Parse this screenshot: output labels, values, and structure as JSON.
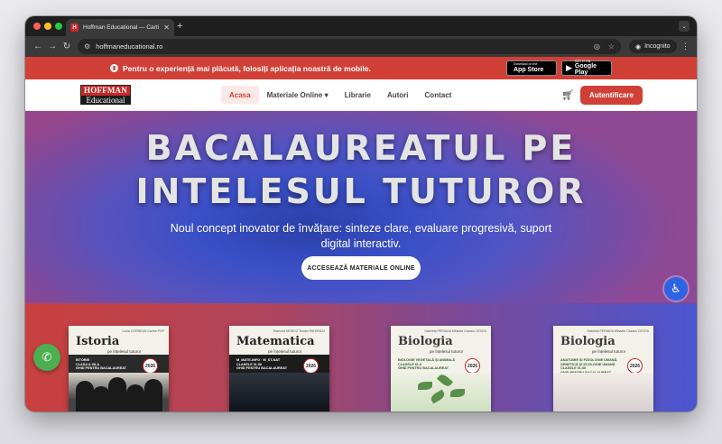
{
  "browser": {
    "tab_title": "Hoffman Educational — Carti",
    "tab_favicon_letter": "H",
    "url": "hoffmaneducational.ro",
    "incognito_label": "Incognito",
    "new_tab_glyph": "+",
    "close_tab_glyph": "✕"
  },
  "promo": {
    "text": "Pentru o experiență mai plăcută, folosiți aplicația noastră de mobile.",
    "apple_small": "Download on the",
    "apple_big": "App Store",
    "google_small": "GET IT ON",
    "google_big": "Google Play",
    "background": "#d14036"
  },
  "nav": {
    "logo_top": "HOFFMAN",
    "logo_bottom": "Educational",
    "items": [
      {
        "label": "Acasa",
        "active": true
      },
      {
        "label": "Materiale Online ▾",
        "active": false
      },
      {
        "label": "Librarie",
        "active": false
      },
      {
        "label": "Autori",
        "active": false
      },
      {
        "label": "Contact",
        "active": false
      }
    ],
    "login_label": "Autentificare",
    "accent": "#d14036"
  },
  "hero": {
    "title_line1": "BACALAUREATUL PE",
    "title_line2": "INTELESUL TUTUROR",
    "subtitle": "Noul concept inovator de învățare: sinteze clare, evaluare progresivă, suport digital interactiv.",
    "cta_label": "ACCESEAZĂ MATERIALE ONLINE"
  },
  "books": [
    {
      "title": "Istoria",
      "subtitle": "pe înțelesul tuturor",
      "authors": "Lucia CORNEAN\nCarina POP",
      "band": "ISTORIE\nCLASA A XII-A\nGHID PENTRU BACALAUREAT",
      "year": "2026"
    },
    {
      "title": "Matematica",
      "subtitle": "pe înțelesul tuturor",
      "authors": "Ramona MOROZ\nTeodor PAHONDU",
      "band": "M_MATE-INFO · M_ST-NAT\nCLASELE IX-XII\nGHID PENTRU BACALAUREAT",
      "year": "2026"
    },
    {
      "title": "Biologia",
      "subtitle": "pe înțelesul tuturor",
      "authors": "Gabriela PERIAGA\nMihaela Cazacu CECEA",
      "band": "BIOLOGIE VEGETALĂ ȘI ANIMALĂ\nCLASELE IX-X\nGHID PENTRU BACALAUREAT",
      "year": "2026"
    },
    {
      "title": "Biologia",
      "subtitle": "pe înțelesul tuturor",
      "authors": "Gabriela PERIAGA\nMihaela Cazacu CECEA",
      "band": "ANATOMIE ȘI FIZIOLOGIE UMANĂ,\nGENETICĂ ȘI ECOLOGIE UMANĂ\nCLASELE XI-XII\nGHID PENTRU BACALAUREAT",
      "year": "2026"
    }
  ]
}
